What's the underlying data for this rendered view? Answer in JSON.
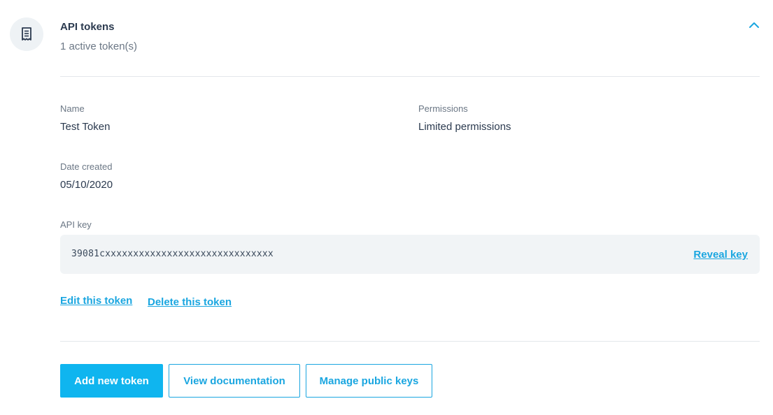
{
  "header": {
    "title": "API tokens",
    "subtitle": "1 active token(s)",
    "icon": "document-icon",
    "toggle_icon": "chevron-up-icon"
  },
  "token": {
    "name_label": "Name",
    "name_value": "Test Token",
    "permissions_label": "Permissions",
    "permissions_value": "Limited permissions",
    "date_label": "Date created",
    "date_value": "05/10/2020",
    "api_key_label": "API key",
    "api_key_value": "39081cxxxxxxxxxxxxxxxxxxxxxxxxxxxxxx",
    "reveal_label": "Reveal key",
    "edit_label": "Edit this token",
    "delete_label": "Delete this token"
  },
  "actions": {
    "add_label": "Add new token",
    "docs_label": "View documentation",
    "public_keys_label": "Manage public keys"
  },
  "colors": {
    "accent": "#0fb5ef",
    "link": "#1aa6e0",
    "text": "#2b3a4f",
    "muted": "#6b7785"
  }
}
